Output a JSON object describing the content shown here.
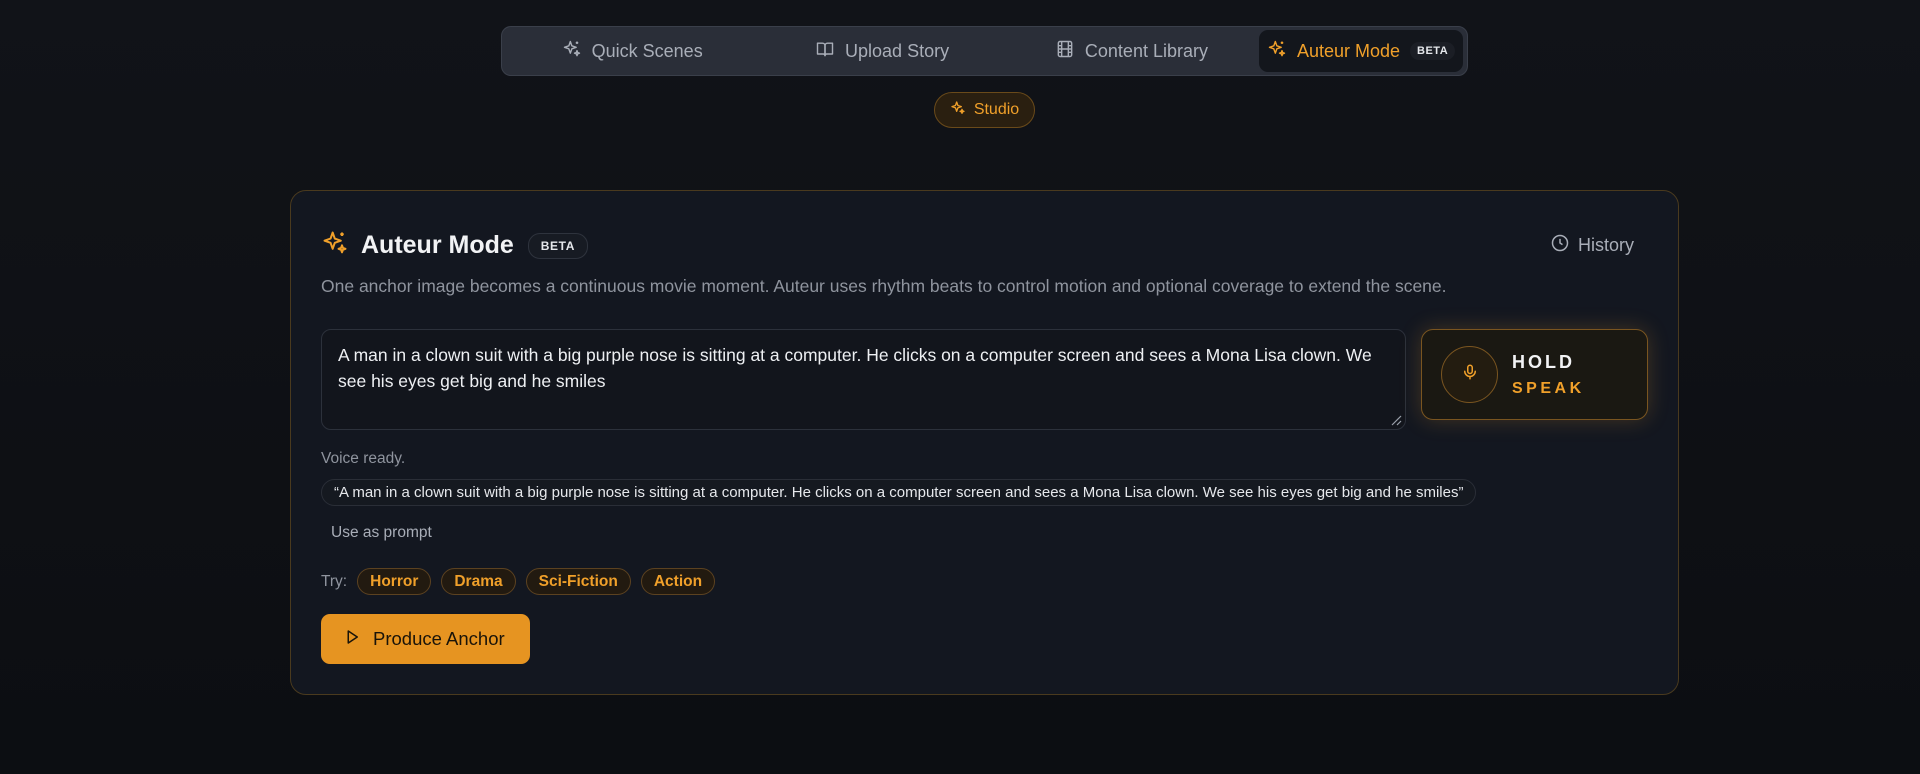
{
  "nav": {
    "tabs": [
      {
        "label": "Quick Scenes",
        "icon": "sparkles-icon"
      },
      {
        "label": "Upload Story",
        "icon": "book-icon"
      },
      {
        "label": "Content Library",
        "icon": "film-icon"
      },
      {
        "label": "Auteur Mode",
        "icon": "sparkles-icon",
        "badge": "BETA",
        "active": true
      }
    ]
  },
  "studio": {
    "label": "Studio"
  },
  "card": {
    "title": "Auteur Mode",
    "badge": "BETA",
    "history_label": "History",
    "subtitle": "One anchor image becomes a continuous movie moment. Auteur uses rhythm beats to control motion and optional coverage to extend the scene.",
    "prompt_value": "A man in a clown suit with a big purple nose is sitting at a computer. He clicks on a computer screen and sees a Mona Lisa clown. We see his eyes get big and he smiles",
    "hold": {
      "line1": "HOLD",
      "line2": "SPEAK"
    },
    "voice_status": "Voice ready.",
    "transcript": "“A man in a clown suit with a big purple nose is sitting at a computer. He clicks on a computer screen and sees a Mona Lisa clown. We see his eyes get big and he smiles”",
    "use_prompt_label": "Use as prompt",
    "try_label": "Try:",
    "genres": [
      "Horror",
      "Drama",
      "Sci-Fiction",
      "Action"
    ],
    "produce_label": "Produce Anchor"
  },
  "colors": {
    "accent": "#f0a02a",
    "button": "#e69421",
    "background": "#0f1116",
    "card": "#131720"
  }
}
